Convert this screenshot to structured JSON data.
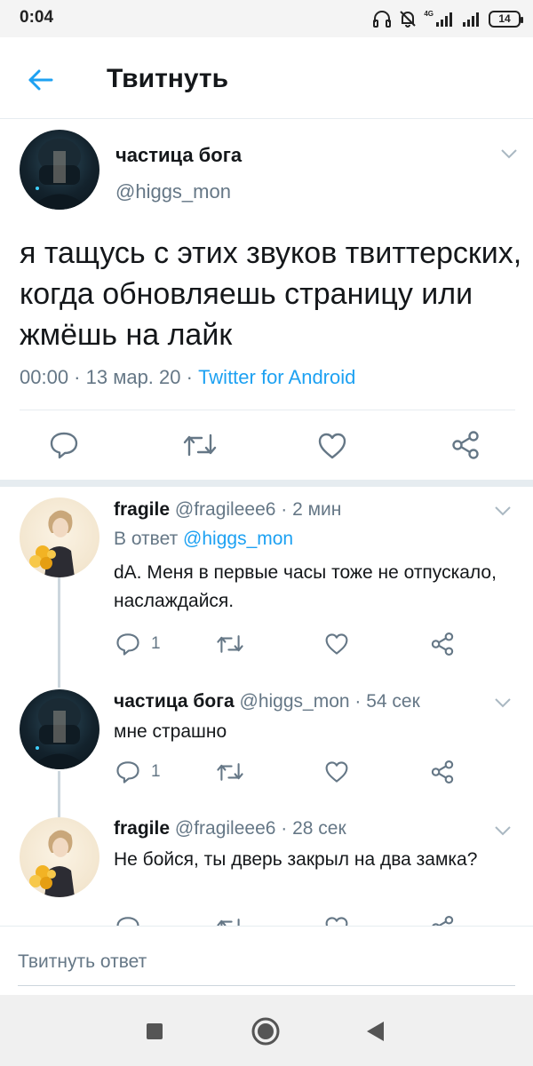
{
  "status_bar": {
    "time": "0:04",
    "network": "4G",
    "battery": "14"
  },
  "header": {
    "title": "Твитнуть",
    "back_icon": "arrow-left-icon"
  },
  "main_tweet": {
    "name": "частица бога",
    "handle": "@higgs_mon",
    "text": "я тащусь с этих звуков твиттерских, когда обновляешь страницу или жмёшь на лайк",
    "time": "00:00",
    "dot1": " · ",
    "date": "13 мар. 20",
    "dot2": " · ",
    "source": "Twitter for Android"
  },
  "replies": [
    {
      "name": "fragile",
      "handle": "@fragileee6",
      "time": " · 2 мин",
      "reply_prefix": "В ответ ",
      "reply_to": "@higgs_mon",
      "text": "dA. Меня в первые часы тоже не отпускало, наслаждайся.",
      "reply_count": "1"
    },
    {
      "name": "частица бога",
      "handle": "@higgs_mon",
      "time": " · 54 сек",
      "text": "мне страшно",
      "reply_count": "1"
    },
    {
      "name": "fragile",
      "handle": "@fragileee6",
      "time": " · 28 сек",
      "text": "Не бойся, ты дверь закрыл на два замка?"
    }
  ],
  "compose": {
    "placeholder": "Твитнуть ответ"
  },
  "colors": {
    "accent": "#1da1f2",
    "secondary_text": "#657786",
    "divider": "#e6ecf0"
  }
}
